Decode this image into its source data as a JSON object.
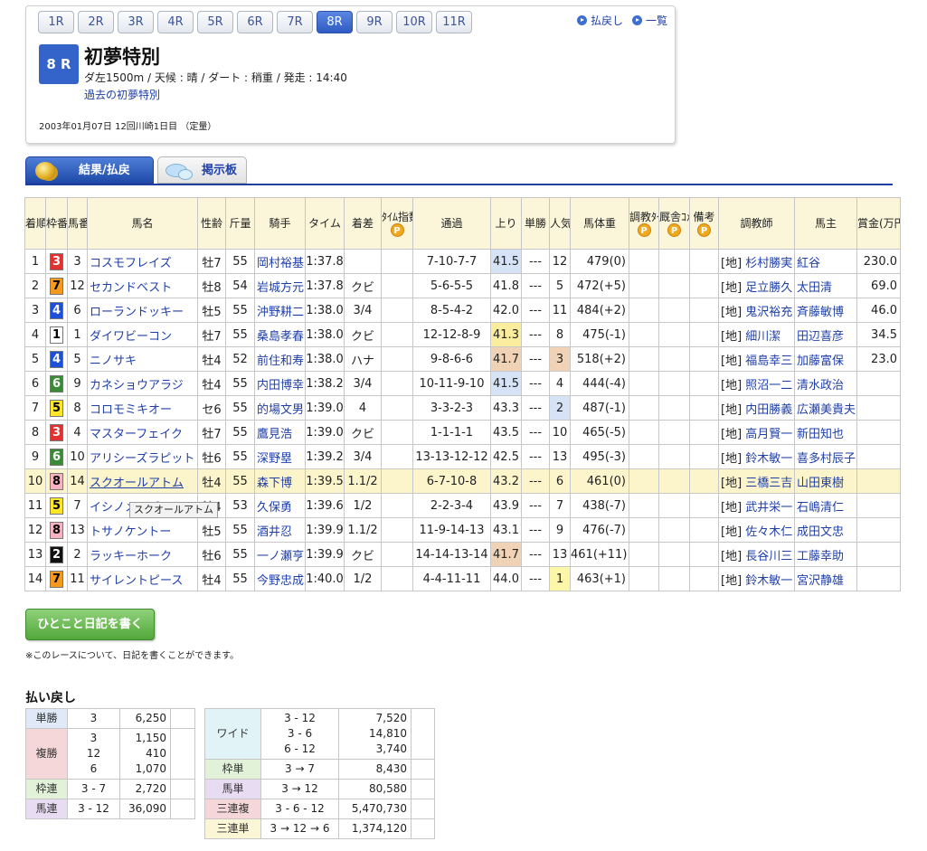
{
  "race_nav": {
    "tabs": [
      "1R",
      "2R",
      "3R",
      "4R",
      "5R",
      "6R",
      "7R",
      "8R",
      "9R",
      "10R",
      "11R"
    ],
    "active": "8R",
    "links": [
      "払戻し",
      "一覧"
    ]
  },
  "race": {
    "badge": "8 R",
    "name": "初夢特別",
    "info": "ダ左1500m /  天候 : 晴 /  ダート : 稍重  /  発走 : 14:40",
    "past_link": "過去の初夢特別",
    "date": "2003年01月07日 12回川崎1日目 （定量）"
  },
  "tabs": {
    "results": "結果/払戻",
    "board": "掲示板"
  },
  "table": {
    "headers": {
      "rank": "着順",
      "waku": "枠番",
      "umaban": "馬番",
      "horse": "馬名",
      "sexage": "性齢",
      "weight": "斤量",
      "jockey": "騎手",
      "time": "タイム",
      "margin": "着差",
      "time_index": "ﾀｲﾑ指数",
      "passing": "通過",
      "agari": "上り",
      "odds": "単勝",
      "popularity": "人気",
      "body_weight": "馬体重",
      "training_time": "調教ﾀｲﾑ",
      "stable_comment": "厩舎ｺﾒﾝﾄ",
      "remarks": "備考",
      "trainer": "調教師",
      "owner": "馬主",
      "prize": "賞金(万円)"
    },
    "p_icon": "P",
    "rows": [
      {
        "rank": "1",
        "waku": "3",
        "umaban": "3",
        "horse": "コスモフレイズ",
        "sexage": "牡7",
        "weight": "55",
        "jockey": "岡村裕基",
        "time": "1:37.8",
        "margin": "",
        "passing": "7-10-7-7",
        "agari": "41.5",
        "agari_rank": 2,
        "odds": "---",
        "pop": "12",
        "pop_rank": 0,
        "body": "479(0)",
        "trainer_region": "[地]",
        "trainer": "杉村勝実",
        "owner": "紅谷",
        "prize": "230.0"
      },
      {
        "rank": "2",
        "waku": "7",
        "umaban": "12",
        "horse": "セカンドベスト",
        "sexage": "牡8",
        "weight": "54",
        "jockey": "岩城方元",
        "time": "1:37.8",
        "margin": "クビ",
        "passing": "5-6-5-5",
        "agari": "41.8",
        "agari_rank": 0,
        "odds": "---",
        "pop": "5",
        "pop_rank": 0,
        "body": "472(+5)",
        "trainer_region": "[地]",
        "trainer": "足立勝久",
        "owner": "太田清",
        "prize": "69.0"
      },
      {
        "rank": "3",
        "waku": "4",
        "umaban": "6",
        "horse": "ローランドッキー",
        "sexage": "牡5",
        "weight": "55",
        "jockey": "沖野耕二",
        "time": "1:38.0",
        "margin": "3/4",
        "passing": "8-5-4-2",
        "agari": "42.0",
        "agari_rank": 0,
        "odds": "---",
        "pop": "11",
        "pop_rank": 0,
        "body": "484(+2)",
        "trainer_region": "[地]",
        "trainer": "鬼沢裕充",
        "owner": "斉藤敏博",
        "prize": "46.0"
      },
      {
        "rank": "4",
        "waku": "1",
        "umaban": "1",
        "horse": "ダイワビーコン",
        "sexage": "牡7",
        "weight": "55",
        "jockey": "桑島孝春",
        "time": "1:38.0",
        "margin": "クビ",
        "passing": "12-12-8-9",
        "agari": "41.3",
        "agari_rank": 1,
        "odds": "---",
        "pop": "8",
        "pop_rank": 0,
        "body": "475(-1)",
        "trainer_region": "[地]",
        "trainer": "細川潔",
        "owner": "田辺喜彦",
        "prize": "34.5"
      },
      {
        "rank": "5",
        "waku": "4",
        "umaban": "5",
        "horse": "ニノサキ",
        "sexage": "牡4",
        "weight": "52",
        "jockey": "前住和寿",
        "time": "1:38.0",
        "margin": "ハナ",
        "passing": "9-8-6-6",
        "agari": "41.7",
        "agari_rank": 3,
        "odds": "---",
        "pop": "3",
        "pop_rank": 3,
        "body": "518(+2)",
        "trainer_region": "[地]",
        "trainer": "福島幸三",
        "owner": "加藤富保",
        "prize": "23.0"
      },
      {
        "rank": "6",
        "waku": "6",
        "umaban": "9",
        "horse": "カネショウアラジ",
        "sexage": "牡4",
        "weight": "55",
        "jockey": "内田博幸",
        "time": "1:38.2",
        "margin": "3/4",
        "passing": "10-11-9-10",
        "agari": "41.5",
        "agari_rank": 2,
        "odds": "---",
        "pop": "4",
        "pop_rank": 0,
        "body": "444(-4)",
        "trainer_region": "[地]",
        "trainer": "照沼一二",
        "owner": "清水政治",
        "prize": ""
      },
      {
        "rank": "7",
        "waku": "5",
        "umaban": "8",
        "horse": "コロモミキオー",
        "sexage": "セ6",
        "weight": "55",
        "jockey": "的場文男",
        "time": "1:39.0",
        "margin": "4",
        "passing": "3-3-2-3",
        "agari": "43.3",
        "agari_rank": 0,
        "odds": "---",
        "pop": "2",
        "pop_rank": 2,
        "body": "487(-1)",
        "trainer_region": "[地]",
        "trainer": "内田勝義",
        "owner": "広瀬美貴夫",
        "prize": ""
      },
      {
        "rank": "8",
        "waku": "3",
        "umaban": "4",
        "horse": "マスターフェイク",
        "sexage": "牡7",
        "weight": "55",
        "jockey": "鷹見浩",
        "time": "1:39.0",
        "margin": "クビ",
        "passing": "1-1-1-1",
        "agari": "43.5",
        "agari_rank": 0,
        "odds": "---",
        "pop": "10",
        "pop_rank": 0,
        "body": "465(-5)",
        "trainer_region": "[地]",
        "trainer": "高月賢一",
        "owner": "新田知也",
        "prize": ""
      },
      {
        "rank": "9",
        "waku": "6",
        "umaban": "10",
        "horse": "アリシーズラピット",
        "sexage": "牡6",
        "weight": "55",
        "jockey": "深野塁",
        "time": "1:39.2",
        "margin": "3/4",
        "passing": "13-13-12-12",
        "agari": "42.5",
        "agari_rank": 0,
        "odds": "---",
        "pop": "13",
        "pop_rank": 0,
        "body": "495(-3)",
        "trainer_region": "[地]",
        "trainer": "鈴木敏一",
        "owner": "喜多村辰子",
        "prize": ""
      },
      {
        "rank": "10",
        "waku": "8",
        "umaban": "14",
        "horse": "スクオールアトム",
        "sexage": "牡4",
        "weight": "55",
        "jockey": "森下博",
        "time": "1:39.5",
        "margin": "1.1/2",
        "passing": "6-7-10-8",
        "agari": "43.2",
        "agari_rank": 0,
        "odds": "---",
        "pop": "6",
        "pop_rank": 0,
        "body": "461(0)",
        "trainer_region": "[地]",
        "trainer": "三橋三吉",
        "owner": "山田東樹",
        "prize": "",
        "highlight": true
      },
      {
        "rank": "11",
        "waku": "5",
        "umaban": "7",
        "horse": "イシノメイビーフー",
        "sexage": "牡4",
        "weight": "53",
        "jockey": "久保勇",
        "time": "1:39.6",
        "margin": "1/2",
        "passing": "2-2-3-4",
        "agari": "43.9",
        "agari_rank": 0,
        "odds": "---",
        "pop": "7",
        "pop_rank": 0,
        "body": "438(-7)",
        "trainer_region": "[地]",
        "trainer": "武井栄一",
        "owner": "石嶋清仁",
        "prize": ""
      },
      {
        "rank": "12",
        "waku": "8",
        "umaban": "13",
        "horse": "トサノケントー",
        "sexage": "牡5",
        "weight": "55",
        "jockey": "酒井忍",
        "time": "1:39.9",
        "margin": "1.1/2",
        "passing": "11-9-14-13",
        "agari": "43.1",
        "agari_rank": 0,
        "odds": "---",
        "pop": "9",
        "pop_rank": 0,
        "body": "476(-7)",
        "trainer_region": "[地]",
        "trainer": "佐々木仁",
        "owner": "成田文忠",
        "prize": ""
      },
      {
        "rank": "13",
        "waku": "2",
        "umaban": "2",
        "horse": "ラッキーホーク",
        "sexage": "牡6",
        "weight": "55",
        "jockey": "一ノ瀬亨",
        "time": "1:39.9",
        "margin": "クビ",
        "passing": "14-14-13-14",
        "agari": "41.7",
        "agari_rank": 3,
        "odds": "---",
        "pop": "13",
        "pop_rank": 0,
        "body": "461(+11)",
        "trainer_region": "[地]",
        "trainer": "長谷川三",
        "owner": "工藤幸助",
        "prize": ""
      },
      {
        "rank": "14",
        "waku": "7",
        "umaban": "11",
        "horse": "サイレントピース",
        "sexage": "牡4",
        "weight": "55",
        "jockey": "今野忠成",
        "time": "1:40.0",
        "margin": "1/2",
        "passing": "4-4-11-11",
        "agari": "44.0",
        "agari_rank": 0,
        "odds": "---",
        "pop": "1",
        "pop_rank": 1,
        "body": "463(+1)",
        "trainer_region": "[地]",
        "trainer": "鈴木敏一",
        "owner": "宮沢静雄",
        "prize": ""
      }
    ]
  },
  "tooltip": "スクオールアトム",
  "diary": {
    "button": "ひとこと日記を書く",
    "note": "※このレースについて、日記を書くことができます。"
  },
  "payouts": {
    "title": "払い戻し",
    "tansho": {
      "label": "単勝",
      "nums": [
        "3"
      ],
      "yen": [
        "6,250"
      ]
    },
    "fukusho": {
      "label": "複勝",
      "nums": [
        "3",
        "12",
        "6"
      ],
      "yen": [
        "1,150",
        "410",
        "1,070"
      ]
    },
    "wakuren": {
      "label": "枠連",
      "nums": [
        "3 - 7"
      ],
      "yen": [
        "2,720"
      ]
    },
    "umaren": {
      "label": "馬連",
      "nums": [
        "3 - 12"
      ],
      "yen": [
        "36,090"
      ]
    },
    "wide": {
      "label": "ワイド",
      "nums": [
        "3 - 12",
        "3 - 6",
        "6 - 12"
      ],
      "yen": [
        "7,520",
        "14,810",
        "3,740"
      ]
    },
    "wakutan": {
      "label": "枠単",
      "nums": [
        "3 → 7"
      ],
      "yen": [
        "8,430"
      ]
    },
    "umatan": {
      "label": "馬単",
      "nums": [
        "3 → 12"
      ],
      "yen": [
        "80,580"
      ]
    },
    "sanrenpuku": {
      "label": "三連複",
      "nums": [
        "3 - 6 - 12"
      ],
      "yen": [
        "5,470,730"
      ]
    },
    "sanrentan": {
      "label": "三連単",
      "nums": [
        "3 → 12 → 6"
      ],
      "yen": [
        "1,374,120"
      ]
    }
  }
}
